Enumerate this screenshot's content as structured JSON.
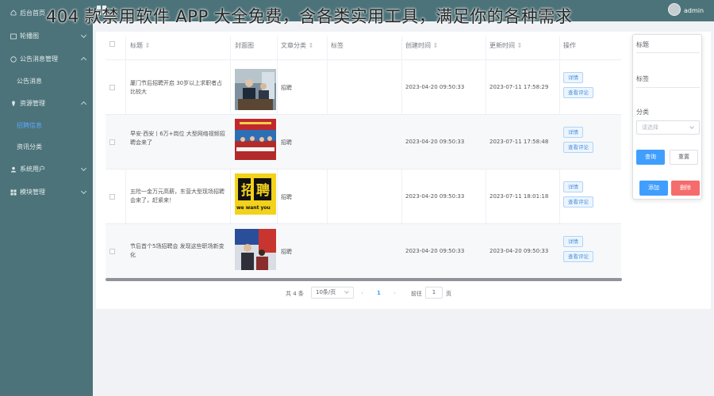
{
  "overlay_text": "404 款禁用软件 APP 大全免费，含各类实用工具，满足你的各种需求",
  "header": {
    "username": "admin"
  },
  "sidebar": {
    "items": [
      {
        "label": "后台首页",
        "icon": "home-icon"
      },
      {
        "label": "轮播图",
        "icon": "image-icon"
      },
      {
        "label": "公告消息管理",
        "icon": "notice-icon"
      },
      {
        "label": "公告消息",
        "sub": true
      },
      {
        "label": "资源管理",
        "icon": "resource-icon"
      },
      {
        "label": "招聘信息",
        "sub": true,
        "active": true
      },
      {
        "label": "资讯分类",
        "sub": true
      },
      {
        "label": "系统用户",
        "icon": "user-icon"
      },
      {
        "label": "模块管理",
        "icon": "module-icon"
      }
    ]
  },
  "table": {
    "headers": [
      "标题",
      "封面图",
      "文章分类",
      "标签",
      "创建时间",
      "更新时间",
      "操作"
    ],
    "rows": [
      {
        "title": "厦门节后招聘开启 30岁以上求职者占比较大",
        "category": "招聘",
        "created": "2023-04-20 09:50:33",
        "updated": "2023-07-11 17:58:29"
      },
      {
        "title": "早安·西安丨6万+岗位 大型网络视频招聘会来了",
        "category": "招聘",
        "created": "2023-04-20 09:50:33",
        "updated": "2023-07-11 17:58:48"
      },
      {
        "title": "五险一金万元高薪，东营大型现场招聘会来了，赶紧来！",
        "category": "招聘",
        "created": "2023-04-20 09:50:33",
        "updated": "2023-07-11 18:01:18"
      },
      {
        "title": "节后首个5场招聘会 发现这些职场新变化",
        "category": "招聘",
        "created": "2023-04-20 09:50:33",
        "updated": "2023-04-20 09:50:33"
      }
    ],
    "actions": {
      "detail": "详情",
      "review": "查看评论"
    }
  },
  "pagination": {
    "total": "共 4 条",
    "page_size": "10条/页",
    "prev": "‹",
    "current": "1",
    "next": "›",
    "goto": "前往",
    "goto_value": "1",
    "page_suffix": "页"
  },
  "filter_panel": {
    "title_label": "标题",
    "tag_label": "标签",
    "category_label": "分类",
    "select_placeholder": "请选择",
    "search_btn": "查询",
    "reset_btn": "重置",
    "add_btn": "添加",
    "delete_btn": "删除"
  },
  "thumbnail_text": {
    "poster_top": "招聘",
    "poster_bottom": "we want you"
  },
  "colors": {
    "sidebar_bg": "#4c7379",
    "primary": "#409eff",
    "danger": "#f56c6c"
  }
}
